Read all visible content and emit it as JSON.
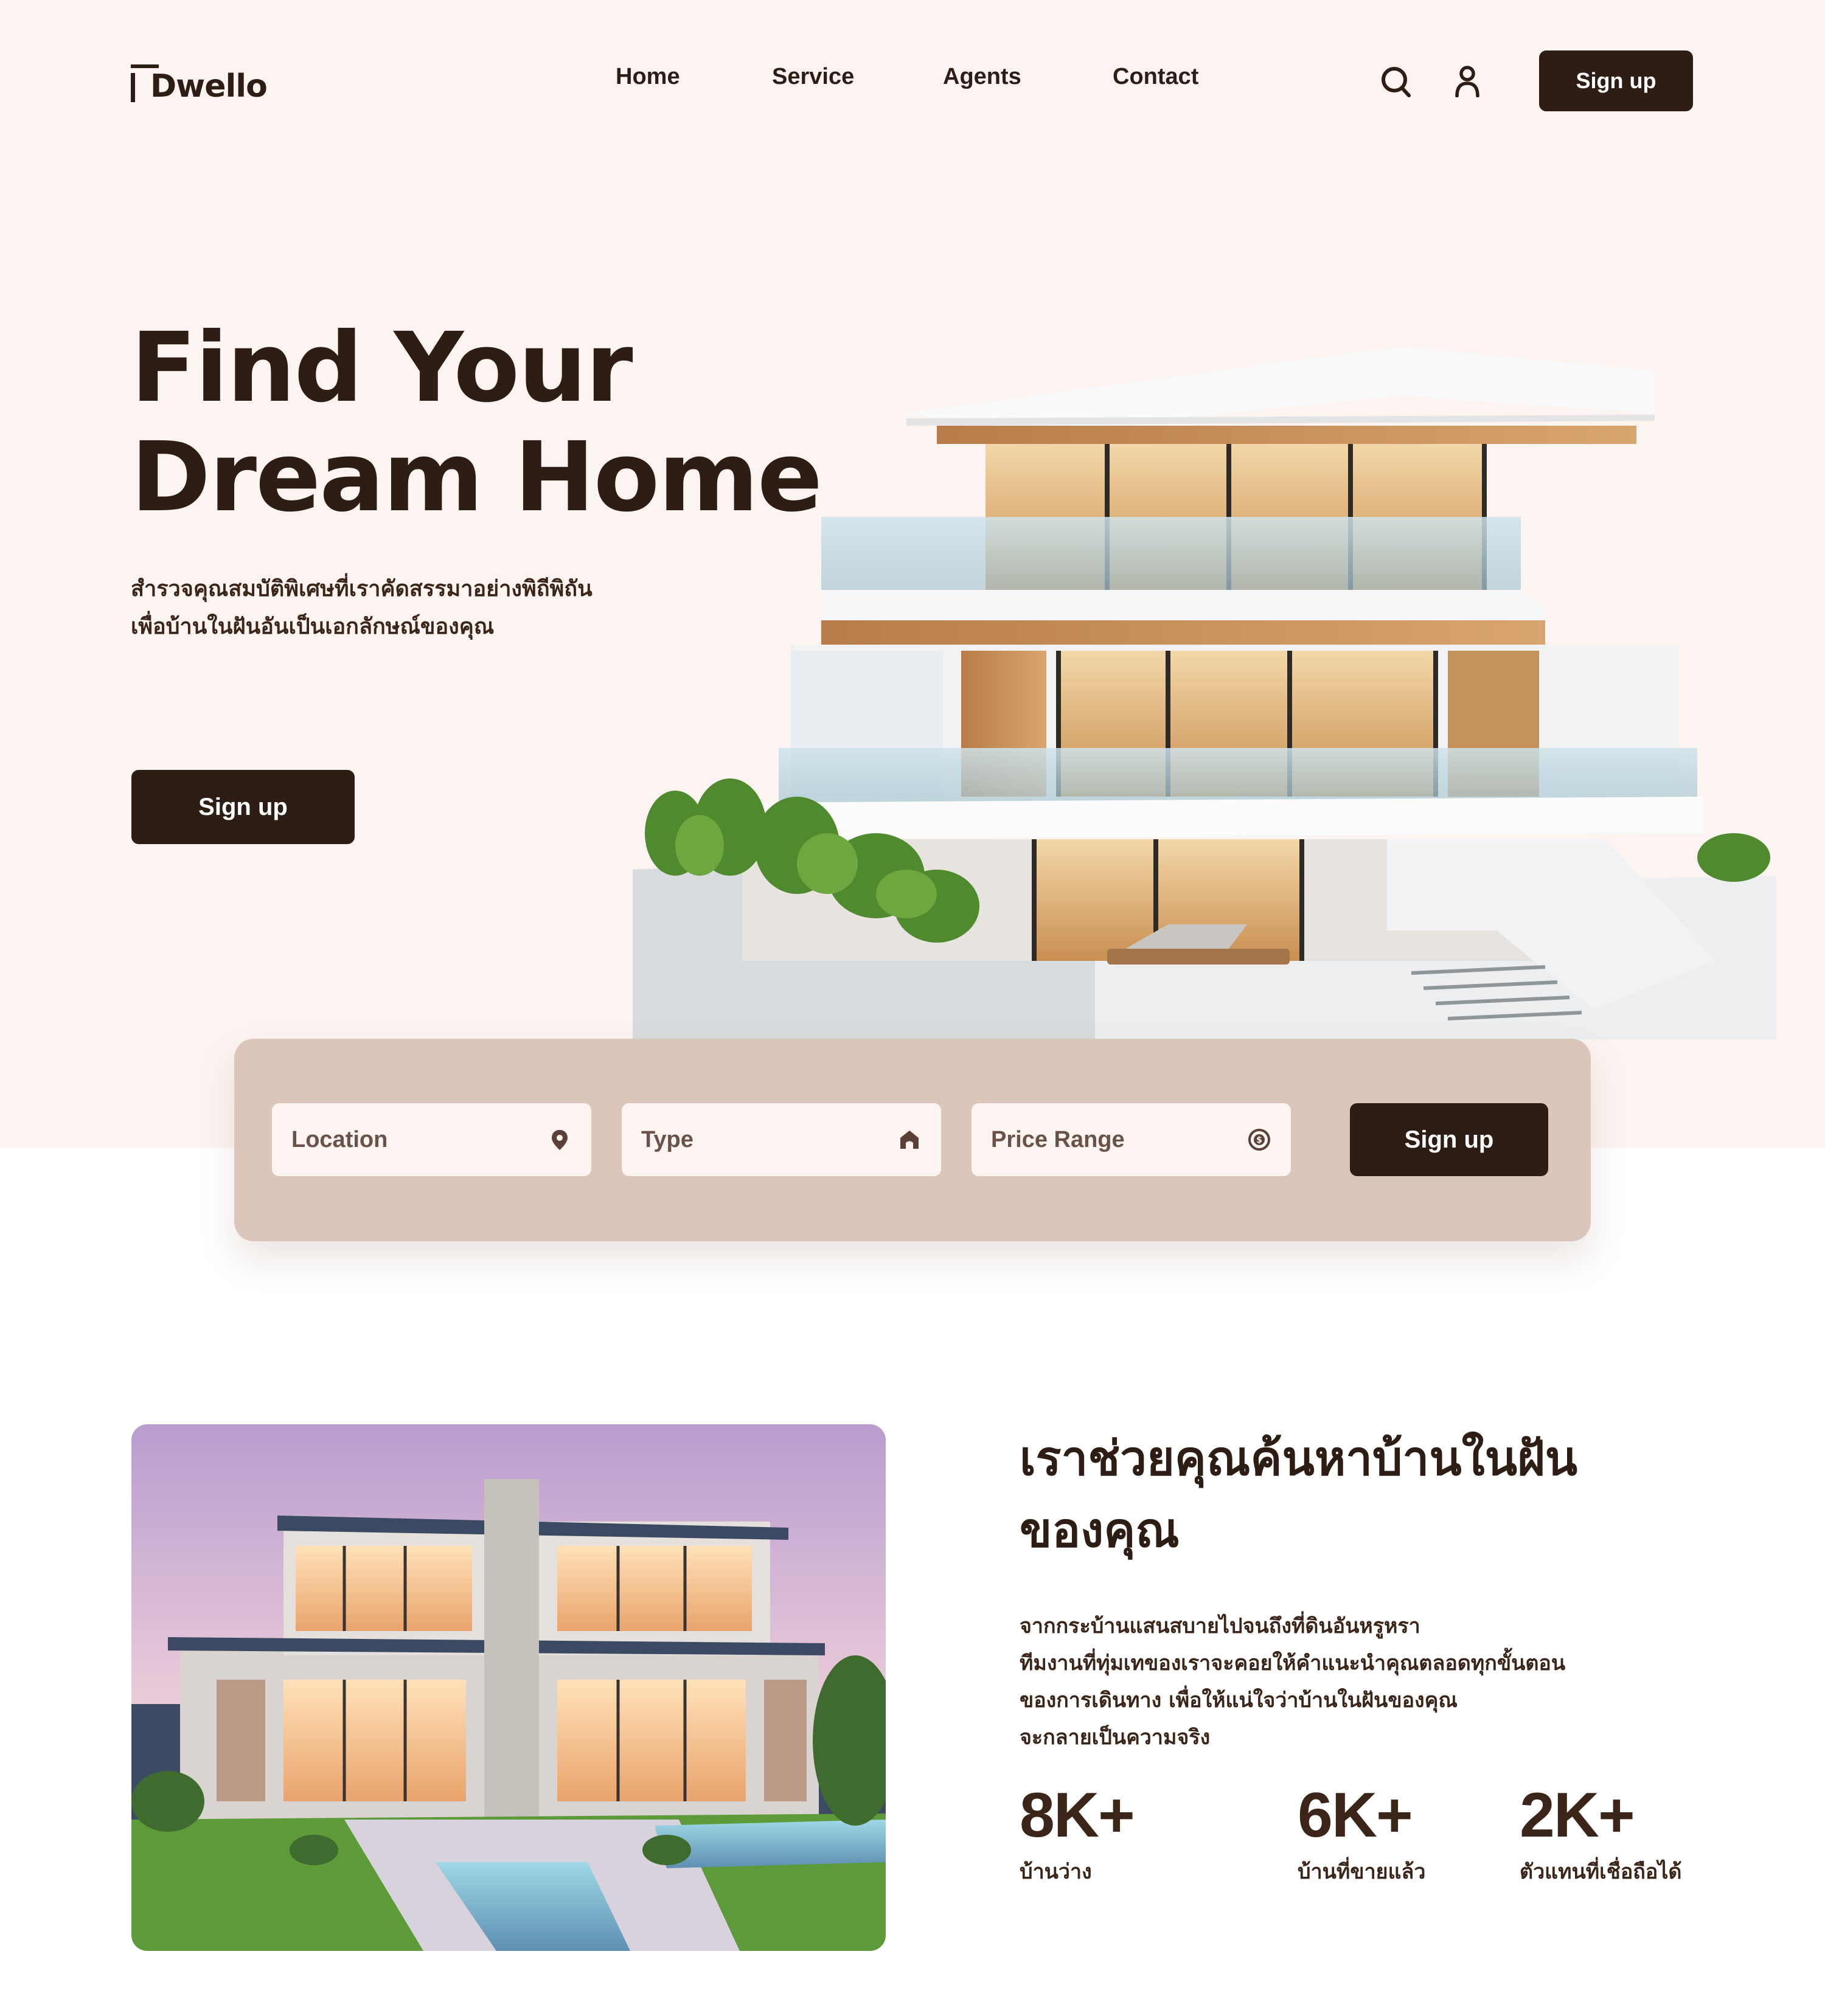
{
  "brand": {
    "name": "Dwello"
  },
  "nav": {
    "items": [
      "Home",
      "Service",
      "Agents",
      "Contact"
    ],
    "signup_label": "Sign up"
  },
  "hero": {
    "title_line1": "Find Your",
    "title_line2": "Dream Home",
    "subtitle_line1": "สำรวจคุณสมบัติพิเศษที่เราคัดสรรมาอย่างพิถีพิถัน",
    "subtitle_line2": "เพื่อบ้านในฝันอันเป็นเอกลักษณ์ของคุณ",
    "signup_label": "Sign up"
  },
  "search": {
    "location_label": "Location",
    "type_label": "Type",
    "price_label": "Price Range",
    "signup_label": "Sign up"
  },
  "about": {
    "title_line1": "เราช่วยคุณค้นหาบ้านในฝัน",
    "title_line2": "ของคุณ",
    "body_lines": [
      "จากกระบ้านแสนสบายไปจนถึงที่ดินอันหรูหรา",
      "ทีมงานที่ทุ่มเทของเราจะคอยให้คำแนะนำคุณตลอดทุกขั้นตอน",
      "ของการเดินทาง เพื่อให้แน่ใจว่าบ้านในฝันของคุณ",
      "จะกลายเป็นความจริง"
    ],
    "stats": [
      {
        "value": "8K+",
        "label": "บ้านว่าง"
      },
      {
        "value": "6K+",
        "label": "บ้านที่ขายแล้ว"
      },
      {
        "value": "2K+",
        "label": "ตัวแทนที่เชื่อถือได้"
      }
    ]
  },
  "colors": {
    "dark": "#2e1d15",
    "hero_bg": "#fcf4f1",
    "panel": "#dcc5ba"
  },
  "icons": [
    "search-icon",
    "user-icon",
    "location-pin-icon",
    "home-icon",
    "dollar-coin-icon"
  ]
}
